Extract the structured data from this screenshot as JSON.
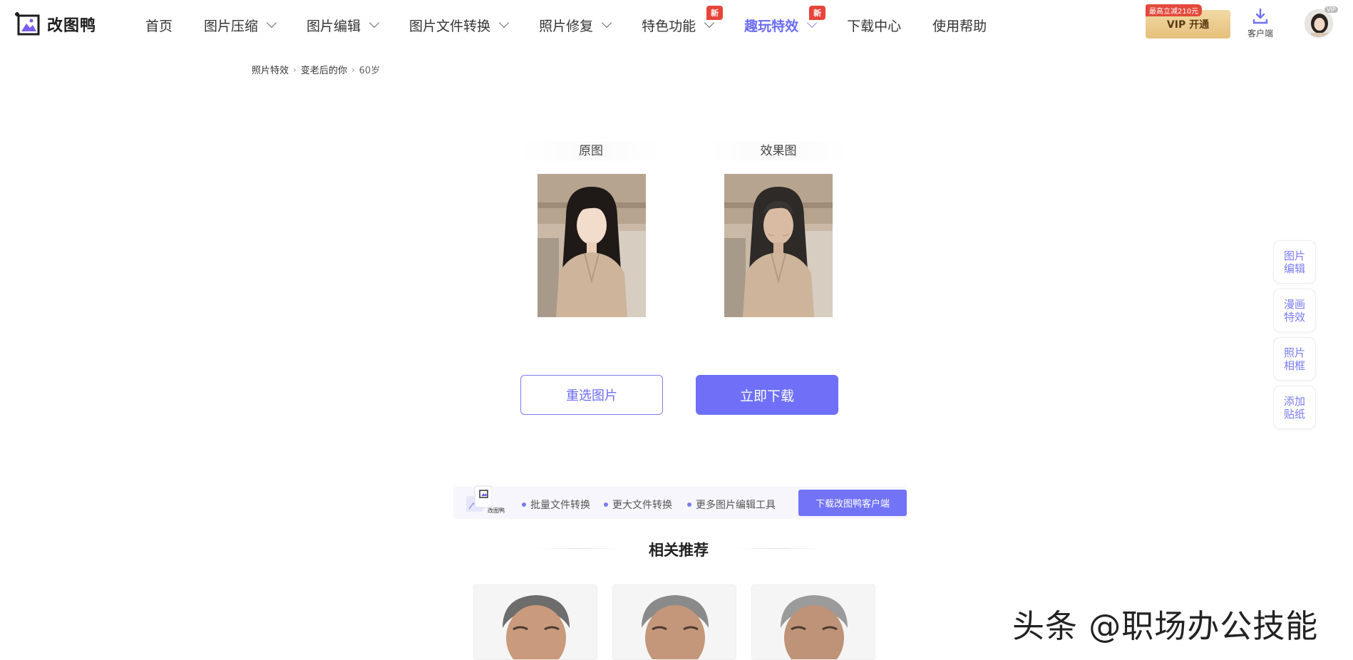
{
  "app": {
    "name": "改图鸭"
  },
  "nav": {
    "items": [
      {
        "label": "首页",
        "dropdown": false
      },
      {
        "label": "图片压缩",
        "dropdown": true
      },
      {
        "label": "图片编辑",
        "dropdown": true
      },
      {
        "label": "图片文件转换",
        "dropdown": true
      },
      {
        "label": "照片修复",
        "dropdown": true
      },
      {
        "label": "特色功能",
        "dropdown": true,
        "badge": "新"
      },
      {
        "label": "趣玩特效",
        "dropdown": true,
        "badge": "新",
        "active": true
      },
      {
        "label": "下载中心",
        "dropdown": false
      },
      {
        "label": "使用帮助",
        "dropdown": false
      }
    ]
  },
  "header": {
    "vip_promo": "最高立减210元",
    "vip_button": "VIP 开通",
    "client_label": "客户端",
    "avatar_badge": "VIP"
  },
  "breadcrumb": [
    "照片特效",
    "变老后的你",
    "60岁"
  ],
  "compare": {
    "original_label": "原图",
    "result_label": "效果图"
  },
  "actions": {
    "reselect": "重选图片",
    "download": "立即下载"
  },
  "side_dock": [
    {
      "line1": "图片",
      "line2": "编辑"
    },
    {
      "line1": "漫画",
      "line2": "特效"
    },
    {
      "line1": "照片",
      "line2": "相框"
    },
    {
      "line1": "添加",
      "line2": "贴纸"
    }
  ],
  "client_banner": {
    "icon_label": "改图鸭",
    "features": [
      "批量文件转换",
      "更大文件转换",
      "更多图片编辑工具"
    ],
    "button": "下载改图鸭客户端"
  },
  "related": {
    "title": "相关推荐"
  },
  "watermark": "头条 @职场办公技能",
  "colors": {
    "accent": "#6f70f7",
    "badge": "#e8443a",
    "vip_gold": "#e6c07d"
  }
}
